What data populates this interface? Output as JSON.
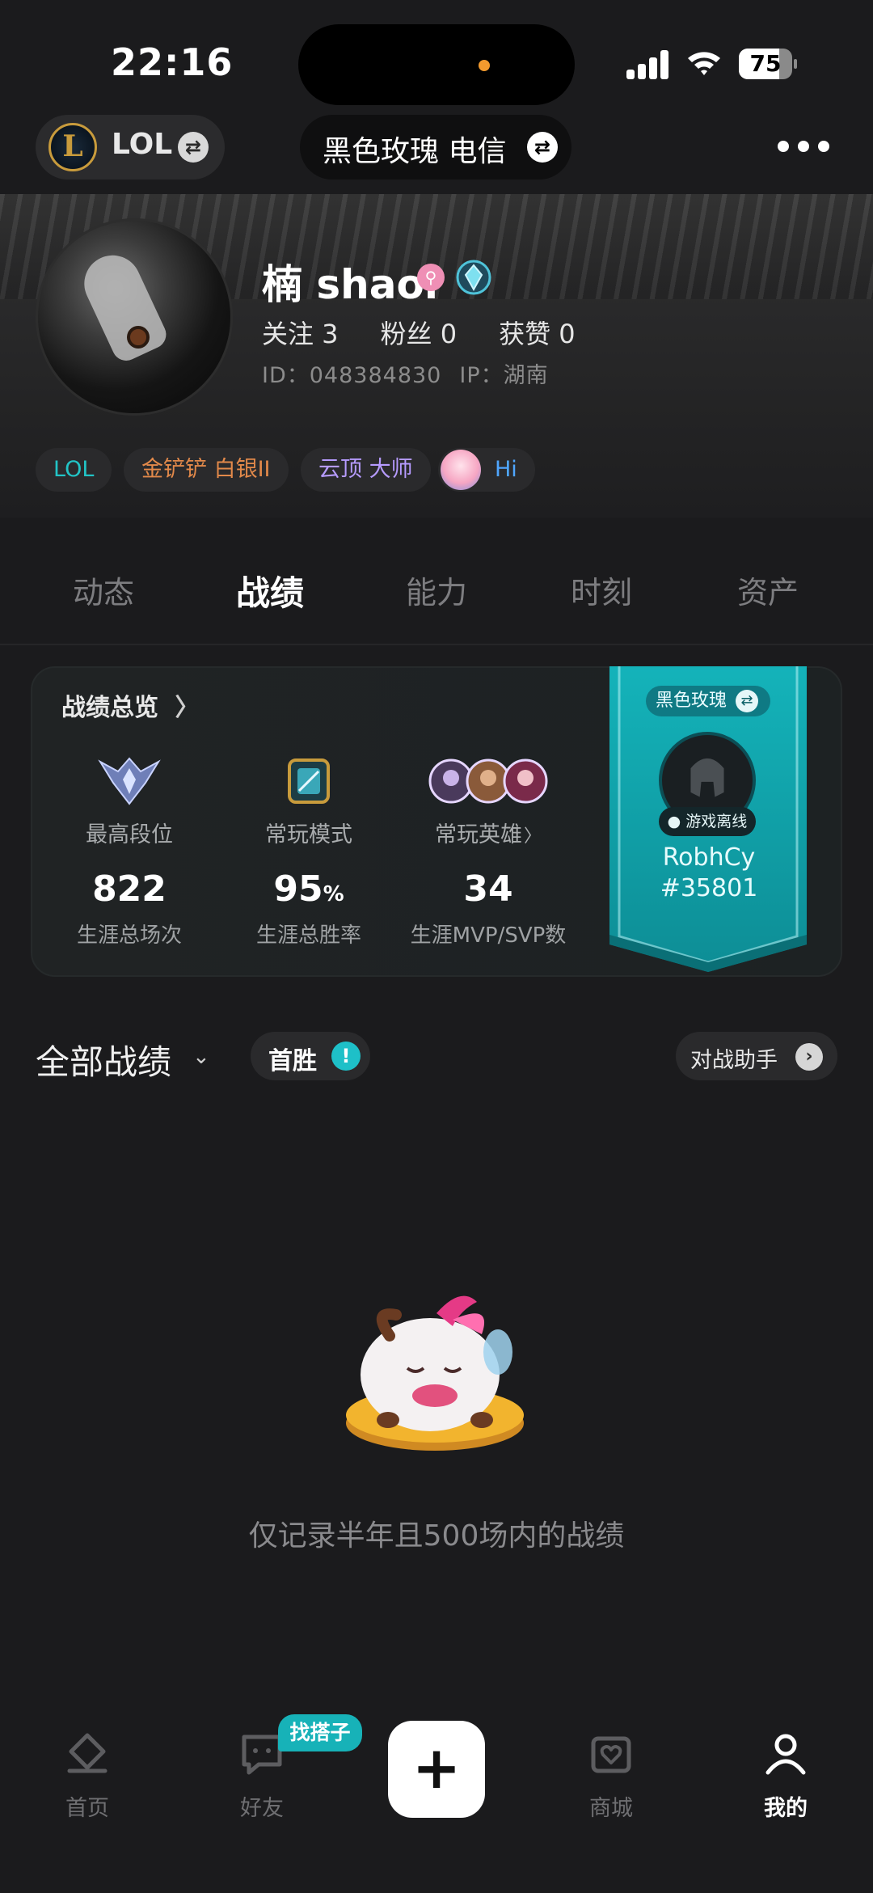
{
  "status_bar": {
    "time": "22:16",
    "battery": "75",
    "battery_level": 0.75
  },
  "header": {
    "game_label": "LOL",
    "server_label": "黑色玫瑰 电信"
  },
  "profile": {
    "name": "楠 shaoi",
    "follow": "关注 3",
    "fans": "粉丝 0",
    "likes": "获赞 0",
    "id": "ID：048384830",
    "ip": "IP：湖南",
    "tags": [
      {
        "label": "LOL",
        "color": "#22c4c6"
      },
      {
        "label": "金铲铲 白银II",
        "color": "#e2894a"
      },
      {
        "label": "云顶 大师",
        "color": "#b69bff"
      },
      {
        "label": "Hi",
        "color": "#4fa6ff"
      }
    ]
  },
  "tabs": [
    {
      "label": "动态",
      "active": false
    },
    {
      "label": "战绩",
      "active": true
    },
    {
      "label": "能力",
      "active": false
    },
    {
      "label": "时刻",
      "active": false
    },
    {
      "label": "资产",
      "active": false
    }
  ],
  "overview": {
    "title": "战绩总览",
    "items": [
      {
        "label": "最高段位",
        "value": "822",
        "unit": "",
        "sub": "生涯总场次",
        "icon": "rank-crest-icon"
      },
      {
        "label": "常玩模式",
        "value": "95",
        "unit": "%",
        "sub": "生涯总胜率",
        "icon": "mode-icon"
      },
      {
        "label": "常玩英雄",
        "value": "34",
        "unit": "",
        "sub": "生涯MVP/SVP数",
        "icon": "champion-avatars-icon"
      }
    ],
    "banner": {
      "server": "黑色玫瑰",
      "status": "游戏离线",
      "name": "RobhCy",
      "tag": "#35801",
      "color": "#13a6ad"
    }
  },
  "filter": {
    "all_label": "全部战绩",
    "first_win": "首胜",
    "assistant": "对战助手"
  },
  "empty_state": {
    "text": "仅记录半年且500场内的战绩"
  },
  "bottom_nav": {
    "items": [
      {
        "label": "首页",
        "icon": "home-icon"
      },
      {
        "label": "好友",
        "icon": "chat-icon"
      },
      {
        "label": "商城",
        "icon": "shop-icon"
      },
      {
        "label": "我的",
        "icon": "profile-icon",
        "active": true
      }
    ],
    "find_badge": "找搭子",
    "add_label": "+"
  }
}
